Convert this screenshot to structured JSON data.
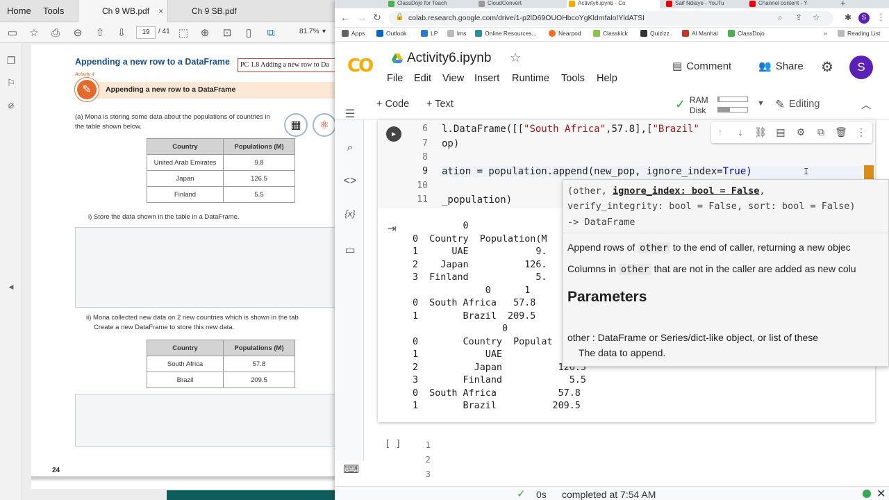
{
  "pdf": {
    "tabs": {
      "home": "Home",
      "tools": "Tools",
      "doc1": "Ch 9 WB.pdf",
      "doc2": "Ch 9 SB.pdf",
      "close": "×"
    },
    "toolbar": {
      "page_current": "19",
      "page_total": "/ 41",
      "zoom": "81.7%"
    },
    "page": {
      "title": "Appending a new row to a DataFrame",
      "pc_box": "PC 1.8 Adding a new row to Da",
      "activity_label": "Activity 4",
      "activity_title": "Appending a new row to a DataFrame",
      "qa": "(a) Mona is storing some data about the populations of countries in the table shown below.",
      "table1": {
        "headers": [
          "Country",
          "Populations (M)"
        ],
        "rows": [
          [
            "United Arab Emirates",
            "9.8"
          ],
          [
            "Japan",
            "126.5"
          ],
          [
            "Finland",
            "5.5"
          ]
        ]
      },
      "qi": "i) Store the data shown in the table in a DataFrame.",
      "qii_line1": "ii) Mona collected new data on 2 new countries which is shown in the tab",
      "qii_line2": "Create a new DataFrame to store this new data.",
      "table2": {
        "headers": [
          "Country",
          "Populations (M)"
        ],
        "rows": [
          [
            "South Africa",
            "57.8"
          ],
          [
            "Brazil",
            "209.5"
          ]
        ]
      },
      "page_number": "24"
    }
  },
  "chrome": {
    "tabs": [
      "ClassDojo for Teach",
      "CloudConvert",
      "Activity6.ipynb - Co",
      "Saif Ndiaye - YouTu",
      "Channel content - Y"
    ],
    "url": "colab.research.google.com/drive/1-p2lD69OUOHbcoYgKldmfaloIYldATSI",
    "profile_initial": "S",
    "bookmarks": [
      "Apps",
      "Outlook",
      "LP",
      "lms",
      "Online Resources...",
      "Nearpod",
      "Classkick",
      "Quizizz",
      "Al Manhal",
      "ClassDojo"
    ],
    "bookmarks_more": "»",
    "reading_list": "Reading List"
  },
  "colab": {
    "logo": "CO",
    "title": "Activity6.ipynb",
    "menu": [
      "File",
      "Edit",
      "View",
      "Insert",
      "Runtime",
      "Tools",
      "Help"
    ],
    "comment": "Comment",
    "share": "Share",
    "avatar": "S",
    "add_code": "+ Code",
    "add_text": "+ Text",
    "ram_label": "RAM",
    "disk_label": "Disk",
    "ram_usage": 0.05,
    "disk_usage": 0.4,
    "editing": "Editing",
    "line_numbers": [
      "6",
      "7",
      "8",
      "9",
      "10",
      "11"
    ],
    "code_lines": [
      {
        "pre": "l.DataFrame([[",
        "s1": "\"South Africa\"",
        "mid": ",57.8],[",
        "s2": "\"Brazil\"",
        "post": ""
      },
      {
        "pre": "op)",
        "s1": "",
        "mid": "",
        "s2": "",
        "post": ""
      },
      {
        "pre": "",
        "s1": "",
        "mid": "",
        "s2": "",
        "post": ""
      },
      {
        "pre": "ation = population.append(new_pop, ignore_index=",
        "s1": "",
        "mid": "",
        "s2": "",
        "post": "True)"
      },
      {
        "pre": "",
        "s1": "",
        "mid": "",
        "s2": "",
        "post": ""
      },
      {
        "pre": "_population)",
        "s1": "",
        "mid": "",
        "s2": "",
        "post": ""
      }
    ],
    "output_lines": [
      "         0",
      "0  Country  Population(M",
      "1      UAE            9.",
      "2    Japan          126.",
      "3  Finland            5.",
      "             0      1",
      "0  South Africa   57.8",
      "1        Brazil  209.5",
      "                0",
      "0        Country  Populat",
      "1            UAE",
      "2          Japan          126.5",
      "3        Finland            5.5",
      "0  South Africa           57.8",
      "1        Brazil          209.5"
    ],
    "tooltip": {
      "sig1a": "(other, ",
      "sig1b": "ignore_index: bool = False",
      "sig1c": ",",
      "sig2": "verify_integrity: bool = False, sort: bool = False)",
      "sig3": "-> DataFrame",
      "p1a": "Append rows of ",
      "p1chip": "other",
      "p1b": " to the end of caller, returning a new objec",
      "p2a": "Columns in ",
      "p2chip": "other",
      "p2b": " that are not in the caller are added as new colu",
      "heading": "Parameters",
      "param1": "other : DataFrame or Series/dict-like object, or list of these",
      "param1_desc": "The data to append."
    },
    "next_cell_bracket": "[ ]",
    "next_cell_lines": [
      "1",
      "2",
      "3"
    ],
    "status_time": "0s",
    "status_text": "completed at 7:54 AM"
  },
  "colors": {
    "accent_orange": "#f9ab00",
    "avatar": "#5b21b6",
    "status_green": "#34a853"
  }
}
